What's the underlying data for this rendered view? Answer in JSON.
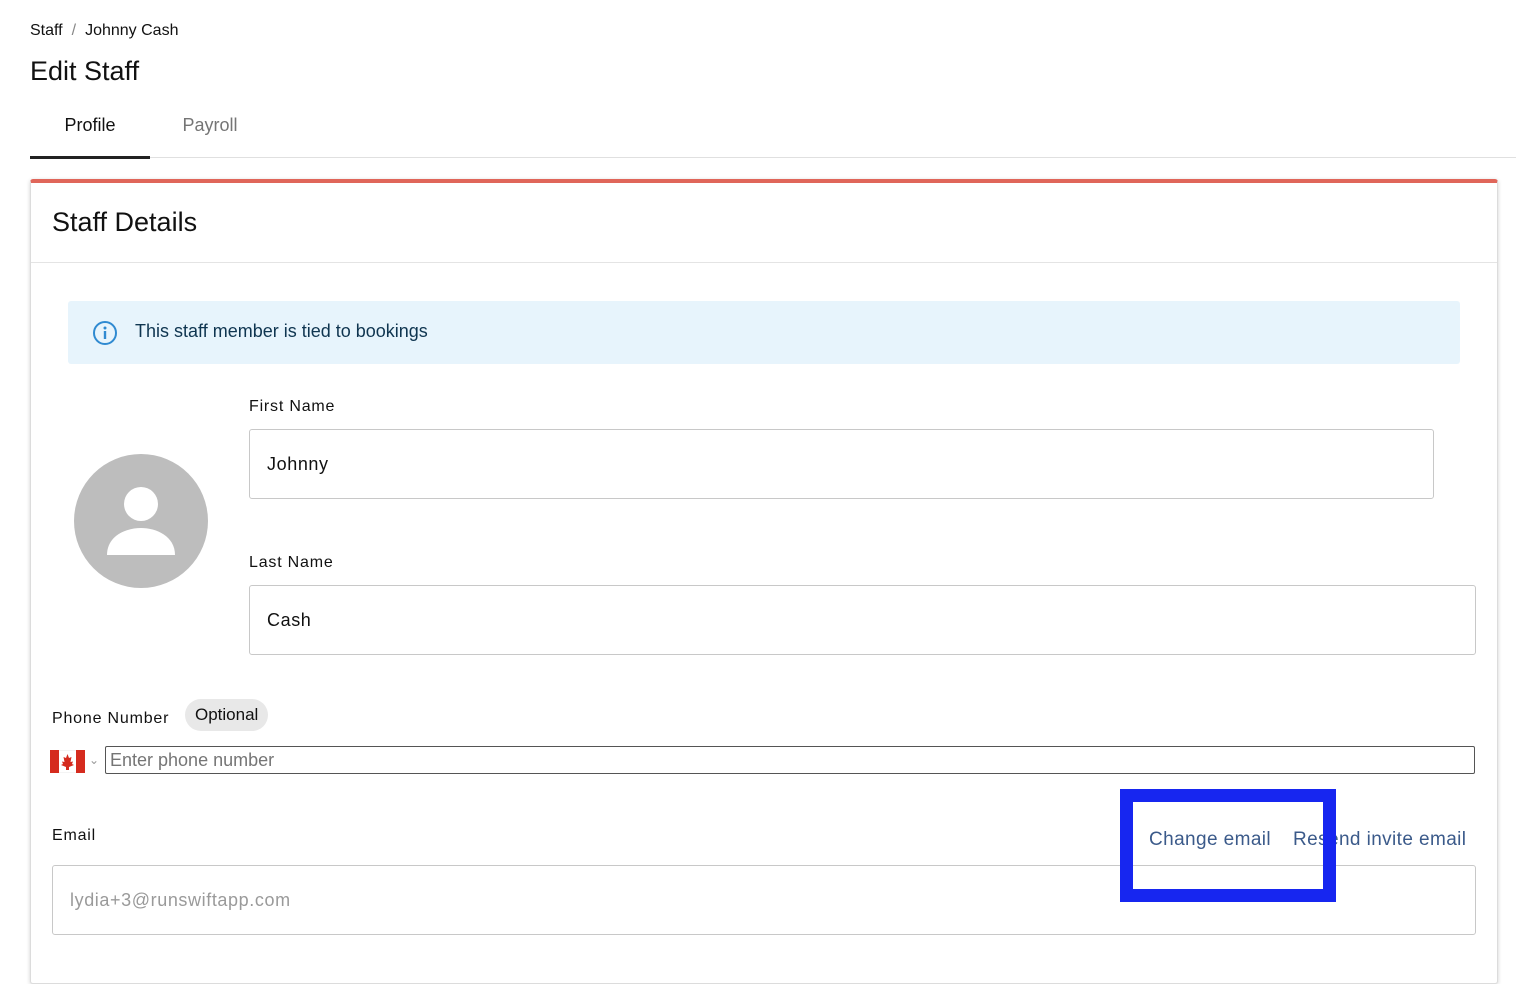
{
  "breadcrumb": {
    "parent": "Staff",
    "separator": "/",
    "current": "Johnny Cash"
  },
  "page": {
    "title": "Edit Staff"
  },
  "tabs": [
    {
      "label": "Profile",
      "active": true
    },
    {
      "label": "Payroll",
      "active": false
    }
  ],
  "card": {
    "title": "Staff Details",
    "accent_color": "#e0665a",
    "info_banner": {
      "icon": "info-icon",
      "text": "This staff member is tied to bookings"
    },
    "avatar": {
      "icon": "person-icon"
    },
    "first_name": {
      "label": "First Name",
      "value": "Johnny"
    },
    "last_name": {
      "label": "Last Name",
      "value": "Cash"
    },
    "phone": {
      "label": "Phone Number",
      "badge": "Optional",
      "country_flag": "canada-flag-icon",
      "placeholder": "Enter phone number",
      "value": ""
    },
    "email": {
      "label": "Email",
      "change_link": "Change email",
      "resend_link": "Resend invite email",
      "value": "lydia+3@runswiftapp.com"
    }
  },
  "annotation": {
    "highlight_color": "#1726f0",
    "target": "Change email"
  }
}
